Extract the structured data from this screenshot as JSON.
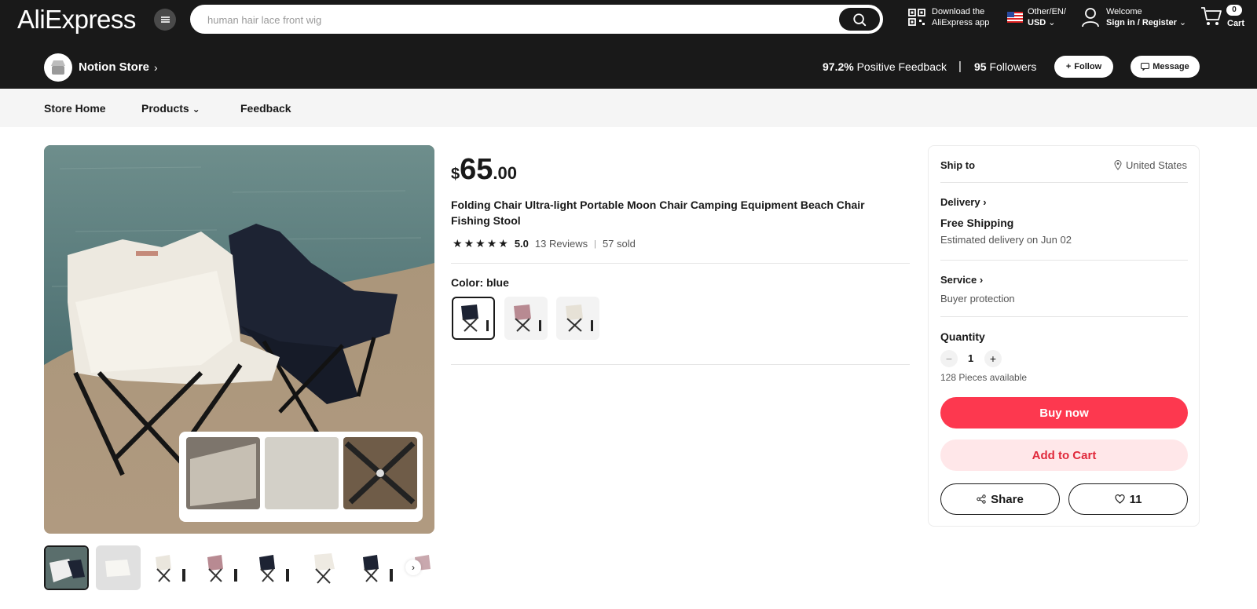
{
  "header": {
    "logo": "AliExpress",
    "search_placeholder": "human hair lace front wig",
    "app_line1": "Download the",
    "app_line2": "AliExpress app",
    "lang_line1": "Other/EN/",
    "lang_line2": "USD",
    "welcome": "Welcome",
    "sign_in": "Sign in / Register",
    "cart_count": "0",
    "cart_label": "Cart"
  },
  "store": {
    "name": "Notion Store",
    "feedback_value": "97.2%",
    "feedback_label": "Positive Feedback",
    "separator": "|",
    "followers_value": "95",
    "followers_label": "Followers",
    "follow_label": "Follow",
    "message_label": "Message"
  },
  "nav": {
    "home": "Store Home",
    "products": "Products",
    "feedback": "Feedback"
  },
  "product": {
    "currency": "$",
    "price_int": "65",
    "price_dec": ".00",
    "title": "Folding Chair Ultra-light Portable Moon Chair Camping Equipment Beach Chair Fishing Stool",
    "rating": "5.0",
    "reviews": "13 Reviews",
    "sold": "57 sold",
    "color_label": "Color: blue",
    "stars": 5
  },
  "panel": {
    "ship_to": "Ship to",
    "location": "United States",
    "delivery": "Delivery",
    "free_shipping": "Free Shipping",
    "estimated": "Estimated delivery on Jun 02",
    "service": "Service",
    "buyer_protection": "Buyer protection",
    "quantity": "Quantity",
    "qty_value": "1",
    "available": "128 Pieces available",
    "buy_now": "Buy now",
    "add_to_cart": "Add to Cart",
    "share": "Share",
    "wishlist_count": "11"
  },
  "colors": {
    "brand_dark": "#191919",
    "buy_red": "#fd384f",
    "cart_pink": "#ffe7e9"
  }
}
